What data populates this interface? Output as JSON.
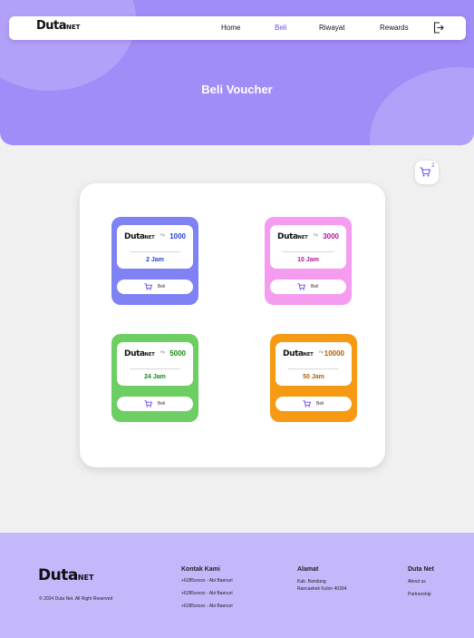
{
  "brand": {
    "logo": "Duta",
    "logo_sub": "NET"
  },
  "nav": {
    "items": [
      {
        "label": "Home"
      },
      {
        "label": "Beli"
      },
      {
        "label": "Riwayat"
      },
      {
        "label": "Rewards"
      }
    ],
    "active": "Beli",
    "logout_icon": "logout-icon"
  },
  "hero": {
    "title": "Beli Voucher"
  },
  "cart": {
    "count": "2",
    "icon": "cart-icon"
  },
  "vouchers": [
    {
      "currency": "Rp",
      "price": "1000",
      "duration": "2 Jam",
      "buy_label": "Beli",
      "color": "#7f82f3",
      "accent": "#2b3fd6"
    },
    {
      "currency": "Rp",
      "price": "3000",
      "duration": "10 Jam",
      "buy_label": "Beli",
      "color": "#f59cf0",
      "accent": "#b3179e"
    },
    {
      "currency": "Rp",
      "price": "5000",
      "duration": "24 Jam",
      "buy_label": "Beli",
      "color": "#6cce63",
      "accent": "#178a17"
    },
    {
      "currency": "Rp",
      "price": "10000",
      "duration": "50 Jam",
      "buy_label": "Beli",
      "color": "#f59a12",
      "accent": "#b35f00"
    }
  ],
  "footer": {
    "copyright": "© 2024 Duta Net. All Right Reserved",
    "contact": {
      "heading": "Kontak Kami",
      "items": [
        "+6285xxxxx - Abi Baenuri",
        "+6285xxxxx - Abi Baenuri",
        "+6285xxxxx - Abi Baenuri"
      ]
    },
    "address": {
      "heading": "Alamat",
      "lines": [
        "Kab. Bandung",
        "Rancaekek Kulon 40394"
      ]
    },
    "company": {
      "heading": "Duta Net",
      "links": [
        "About us",
        "Partnership"
      ]
    }
  },
  "colors": {
    "primary": "#a18cf8",
    "footer": "#c4b8fb",
    "accent": "#6a4bf0"
  }
}
